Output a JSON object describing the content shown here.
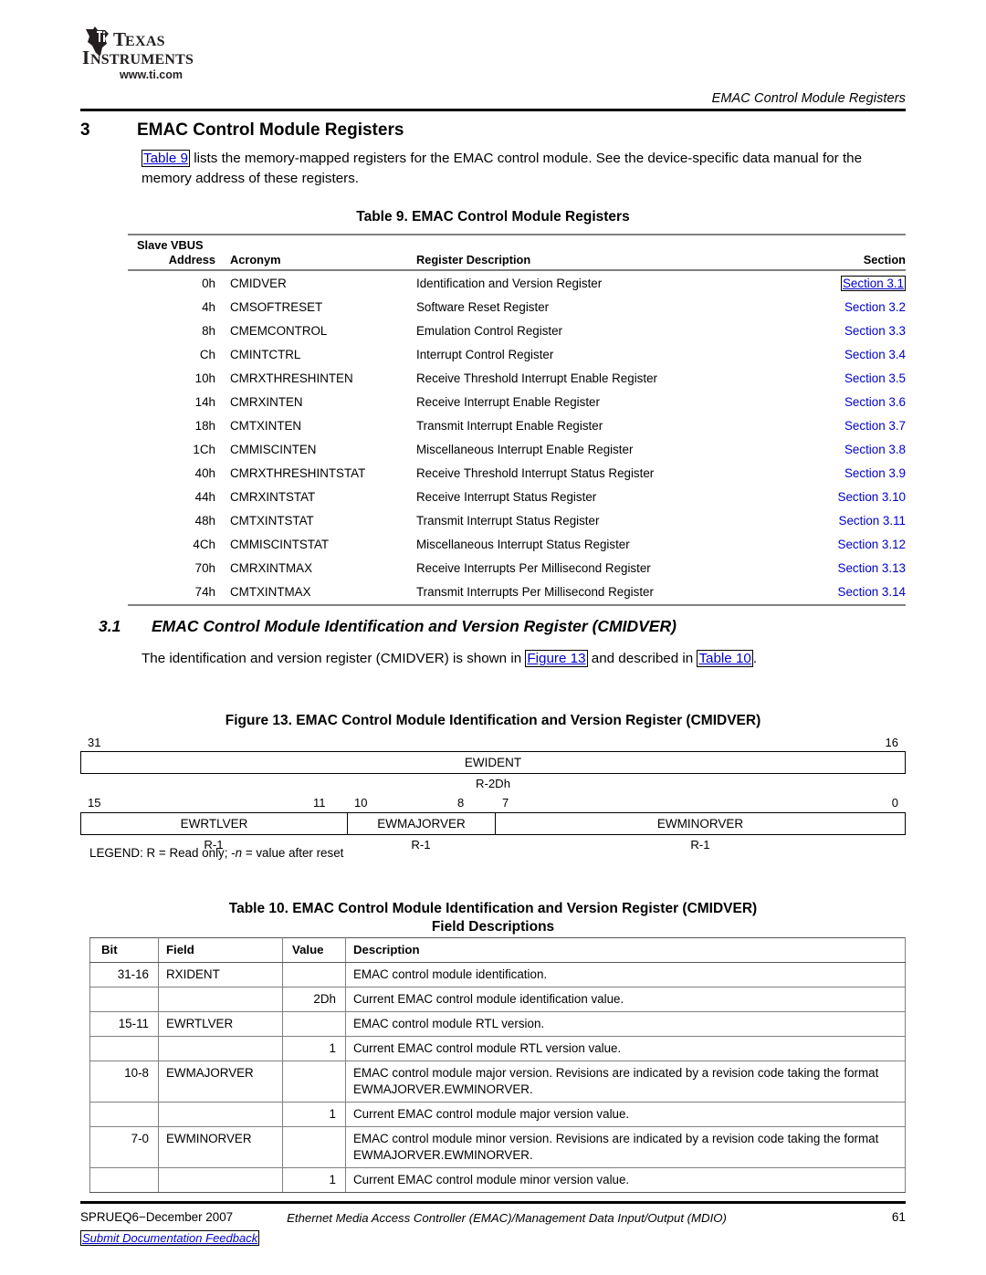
{
  "header": {
    "logo_name": "Texas Instruments",
    "logo_line1": "TEXAS",
    "logo_line2": "INSTRUMENTS",
    "logo_url": "www.ti.com",
    "running_title": "EMAC Control Module Registers"
  },
  "section3": {
    "number": "3",
    "title": "EMAC Control Module Registers",
    "para_pre": "",
    "para_link": "Table 9",
    "para_post": " lists the memory-mapped registers for the EMAC control module. See the device-specific data manual for the memory address of these registers."
  },
  "table9": {
    "caption": "Table 9. EMAC Control Module Registers",
    "header_addr_line1": "Slave VBUS",
    "header_addr_line2": "Address",
    "header_acronym": "Acronym",
    "header_description": "Register Description",
    "header_section": "Section",
    "rows": [
      {
        "address": "0h",
        "acronym": "CMIDVER",
        "description": "Identification and Version Register",
        "section": "Section 3.1",
        "selected": true
      },
      {
        "address": "4h",
        "acronym": "CMSOFTRESET",
        "description": "Software Reset Register",
        "section": "Section 3.2",
        "selected": false
      },
      {
        "address": "8h",
        "acronym": "CMEMCONTROL",
        "description": "Emulation Control Register",
        "section": "Section 3.3",
        "selected": false
      },
      {
        "address": "Ch",
        "acronym": "CMINTCTRL",
        "description": "Interrupt Control Register",
        "section": "Section 3.4",
        "selected": false
      },
      {
        "address": "10h",
        "acronym": "CMRXTHRESHINTEN",
        "description": "Receive Threshold Interrupt Enable Register",
        "section": "Section 3.5",
        "selected": false
      },
      {
        "address": "14h",
        "acronym": "CMRXINTEN",
        "description": "Receive Interrupt Enable Register",
        "section": "Section 3.6",
        "selected": false
      },
      {
        "address": "18h",
        "acronym": "CMTXINTEN",
        "description": "Transmit Interrupt Enable Register",
        "section": "Section 3.7",
        "selected": false
      },
      {
        "address": "1Ch",
        "acronym": "CMMISCINTEN",
        "description": "Miscellaneous Interrupt Enable Register",
        "section": "Section 3.8",
        "selected": false
      },
      {
        "address": "40h",
        "acronym": "CMRXTHRESHINTSTAT",
        "description": "Receive Threshold Interrupt Status Register",
        "section": "Section 3.9",
        "selected": false
      },
      {
        "address": "44h",
        "acronym": "CMRXINTSTAT",
        "description": "Receive Interrupt Status Register",
        "section": "Section 3.10",
        "selected": false
      },
      {
        "address": "48h",
        "acronym": "CMTXINTSTAT",
        "description": "Transmit Interrupt Status Register",
        "section": "Section 3.11",
        "selected": false
      },
      {
        "address": "4Ch",
        "acronym": "CMMISCINTSTAT",
        "description": "Miscellaneous Interrupt Status Register",
        "section": "Section 3.12",
        "selected": false
      },
      {
        "address": "70h",
        "acronym": "CMRXINTMAX",
        "description": "Receive Interrupts Per Millisecond Register",
        "section": "Section 3.13",
        "selected": false
      },
      {
        "address": "74h",
        "acronym": "CMTXINTMAX",
        "description": "Transmit Interrupts Per Millisecond Register",
        "section": "Section 3.14",
        "selected": false
      }
    ]
  },
  "section31": {
    "number": "3.1",
    "title": "EMAC Control Module Identification and Version Register (CMIDVER)",
    "para_pre": "The identification and version register (CMIDVER) is shown in ",
    "para_link1": "Figure 13",
    "para_mid": " and described in ",
    "para_link2": "Table 10",
    "para_post": "."
  },
  "figure13": {
    "caption": "Figure 13. EMAC Control Module Identification and Version Register (CMIDVER)",
    "row1": {
      "bit_left": "31",
      "bit_right": "16",
      "fields": [
        {
          "name": "EWIDENT",
          "reset": "R-2Dh"
        }
      ]
    },
    "row2": {
      "bit_marks": [
        "15",
        "11",
        "10",
        "8",
        "7",
        "0"
      ],
      "fields": [
        {
          "name": "EWRTLVER",
          "reset": "R-1"
        },
        {
          "name": "EWMAJORVER",
          "reset": "R-1"
        },
        {
          "name": "EWMINORVER",
          "reset": "R-1"
        }
      ]
    },
    "legend_pre": "LEGEND: R = Read only; -",
    "legend_italic": "n",
    "legend_post": " = value after reset"
  },
  "table10": {
    "caption_line1": "Table 10. EMAC Control Module Identification and Version Register (CMIDVER)",
    "caption_line2": "Field Descriptions",
    "header_bit": "Bit",
    "header_field": "Field",
    "header_value": "Value",
    "header_description": "Description",
    "rows": [
      {
        "bit": "31-16",
        "field": "RXIDENT",
        "value": "",
        "description": "EMAC control module identification.",
        "group_start": true
      },
      {
        "bit": "",
        "field": "",
        "value": "2Dh",
        "description": "Current EMAC control module identification value.",
        "group_start": false
      },
      {
        "bit": "15-11",
        "field": "EWRTLVER",
        "value": "",
        "description": "EMAC control module RTL version.",
        "group_start": true
      },
      {
        "bit": "",
        "field": "",
        "value": "1",
        "description": "Current EMAC control module RTL version value.",
        "group_start": false
      },
      {
        "bit": "10-8",
        "field": "EWMAJORVER",
        "value": "",
        "description": "EMAC control module major version. Revisions are indicated by a revision code taking the format EWMAJORVER.EWMINORVER.",
        "group_start": true
      },
      {
        "bit": "",
        "field": "",
        "value": "1",
        "description": "Current EMAC control module major version value.",
        "group_start": false
      },
      {
        "bit": "7-0",
        "field": "EWMINORVER",
        "value": "",
        "description": "EMAC control module minor version. Revisions are indicated by a revision code taking the format EWMAJORVER.EWMINORVER.",
        "group_start": true
      },
      {
        "bit": "",
        "field": "",
        "value": "1",
        "description": "Current EMAC control module minor version value.",
        "group_start": false
      }
    ]
  },
  "footer": {
    "doc_id": "SPRUEQ6−December 2007",
    "title": "Ethernet Media Access Controller (EMAC)/Management Data Input/Output (MDIO)",
    "page_number": "61",
    "feedback_link": "Submit Documentation Feedback"
  },
  "colors": {
    "link_blue": "#0000cc",
    "rule_black": "#000000",
    "table_rule_gray": "#808080"
  }
}
